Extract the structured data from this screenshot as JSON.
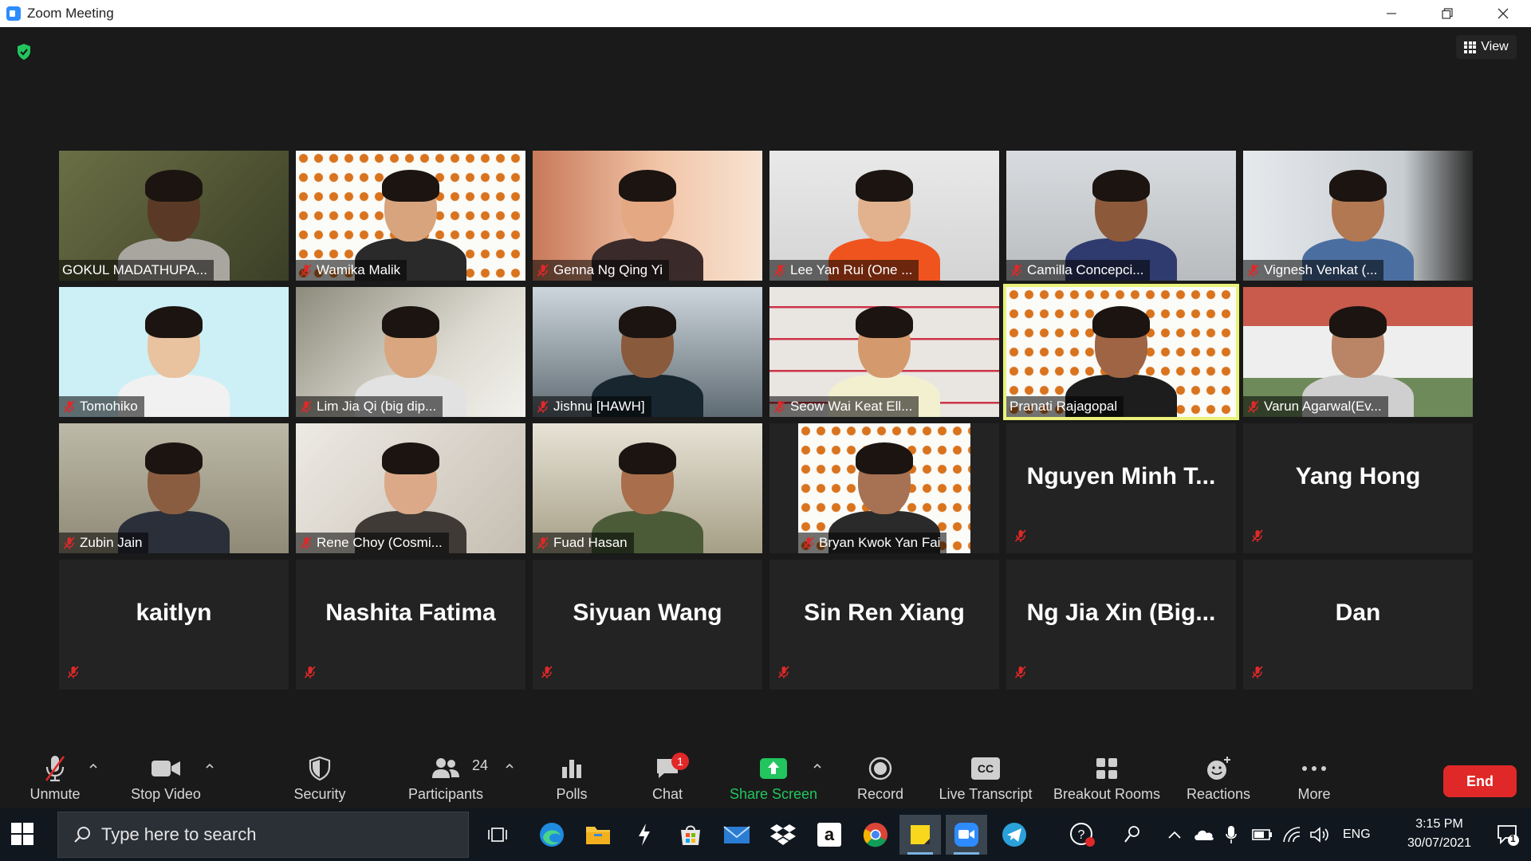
{
  "window": {
    "title": "Zoom Meeting"
  },
  "view_button": {
    "label": "View"
  },
  "participants_gallery": [
    {
      "name": "GOKUL MADATHUPA...",
      "video": true,
      "muted": false
    },
    {
      "name": "Wamika Malik",
      "video": true,
      "muted": true
    },
    {
      "name": "Genna Ng Qing Yi",
      "video": true,
      "muted": true
    },
    {
      "name": "Lee Yan Rui (One ...",
      "video": true,
      "muted": true
    },
    {
      "name": "Camilla Concepci...",
      "video": true,
      "muted": true
    },
    {
      "name": "Vignesh Venkat (...",
      "video": true,
      "muted": true
    },
    {
      "name": "Tomohiko",
      "video": true,
      "muted": true
    },
    {
      "name": "Lim Jia Qi (big dip...",
      "video": true,
      "muted": true
    },
    {
      "name": "Jishnu [HAWH]",
      "video": true,
      "muted": true
    },
    {
      "name": "Seow Wai Keat Ell...",
      "video": true,
      "muted": true
    },
    {
      "name": "Pranati Rajagopal",
      "video": true,
      "muted": false,
      "speaking": true
    },
    {
      "name": "Varun Agarwal(Ev...",
      "video": true,
      "muted": true
    },
    {
      "name": "Zubin Jain",
      "video": true,
      "muted": true
    },
    {
      "name": "Rene Choy (Cosmi...",
      "video": true,
      "muted": true
    },
    {
      "name": "Fuad Hasan",
      "video": true,
      "muted": true
    },
    {
      "name": "Bryan Kwok Yan Fai",
      "video": true,
      "muted": true
    },
    {
      "name": "Nguyen Minh T...",
      "video": false,
      "muted": true
    },
    {
      "name": "Yang Hong",
      "video": false,
      "muted": true
    },
    {
      "name": "kaitlyn",
      "video": false,
      "muted": true
    },
    {
      "name": "Nashita Fatima",
      "video": false,
      "muted": true
    },
    {
      "name": "Siyuan Wang",
      "video": false,
      "muted": true
    },
    {
      "name": "Sin Ren Xiang",
      "video": false,
      "muted": true
    },
    {
      "name": "Ng Jia Xin (Big...",
      "video": false,
      "muted": true
    },
    {
      "name": "Dan",
      "video": false,
      "muted": true
    }
  ],
  "toolbar": {
    "unmute": "Unmute",
    "stop_video": "Stop Video",
    "security": "Security",
    "participants": "Participants",
    "participants_count": "24",
    "polls": "Polls",
    "chat": "Chat",
    "chat_badge": "1",
    "share_screen": "Share Screen",
    "record": "Record",
    "live_transcript": "Live Transcript",
    "cc_glyph": "CC",
    "breakout_rooms": "Breakout Rooms",
    "reactions": "Reactions",
    "more": "More",
    "end": "End"
  },
  "taskbar": {
    "search_placeholder": "Type here to search",
    "language": "ENG",
    "time": "3:15 PM",
    "date": "30/07/2021",
    "notification_count": "1",
    "amazon_letter": "a"
  },
  "colors": {
    "share_green": "#22c55e",
    "end_red": "#e02828",
    "speaking_border": "#e9f27a",
    "zoom_blue": "#2D8CFF",
    "muted_red": "#e02828"
  }
}
